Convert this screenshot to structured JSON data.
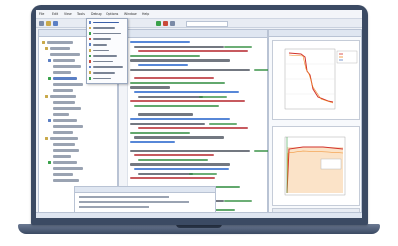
{
  "menubar": {
    "items": [
      "File",
      "Edit",
      "View",
      "Tools",
      "Debug",
      "Options",
      "Window",
      "Help"
    ]
  },
  "tree": {
    "title": ""
  },
  "editor": {
    "tab_label": ""
  },
  "plots": {
    "title": ""
  },
  "dropdown": {
    "items": [
      "",
      "",
      "",
      "",
      "",
      "",
      "",
      "",
      "",
      "",
      ""
    ]
  },
  "icons": {
    "run": "play-icon",
    "stop": "stop-icon",
    "save": "save-icon"
  },
  "colors": {
    "bezel": "#3b4a63",
    "code_keyword": "#1f5fc9",
    "code_string": "#b4232a",
    "code_comment": "#2e8b3c",
    "plot_red": "#d2312b",
    "plot_orange": "#f08a24"
  }
}
